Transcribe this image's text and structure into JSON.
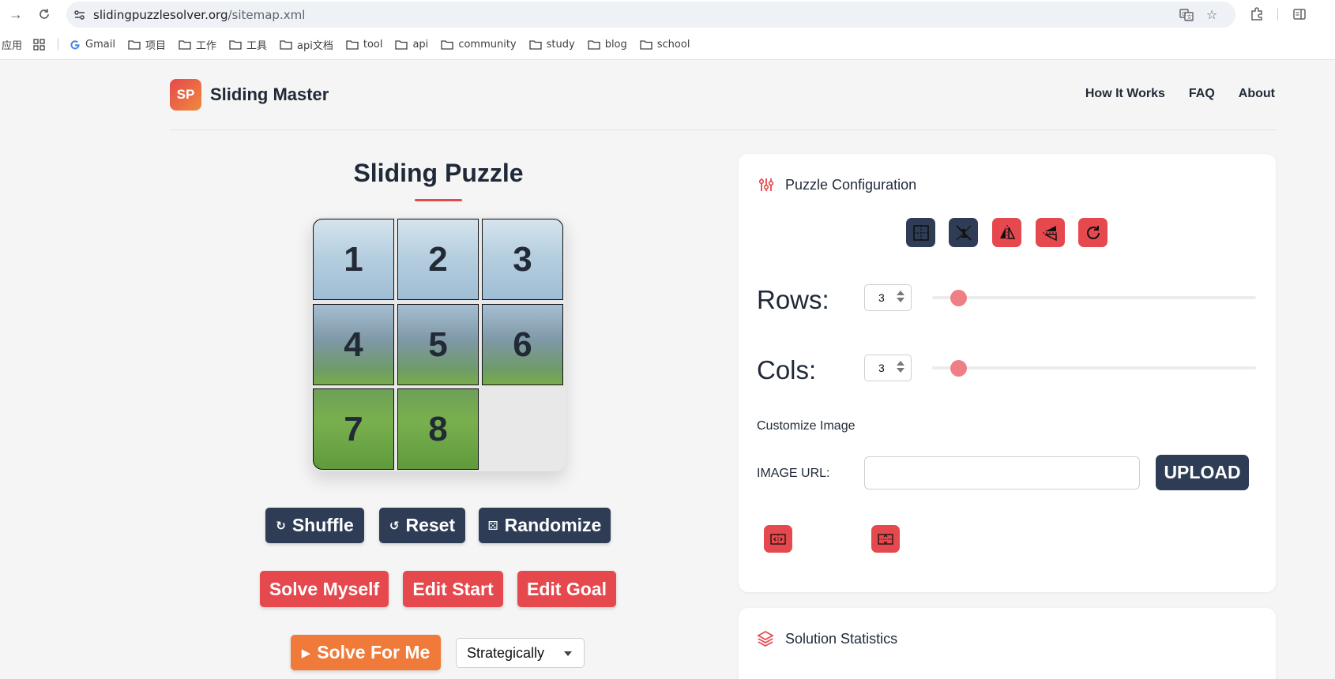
{
  "browser": {
    "url_domain": "slidingpuzzlesolver.org",
    "url_path": "/sitemap.xml",
    "bookmarks": [
      "应用",
      "Gmail",
      "项目",
      "工作",
      "工具",
      "api文档",
      "tool",
      "api",
      "community",
      "study",
      "blog",
      "school"
    ]
  },
  "header": {
    "logo_text": "SP",
    "brand": "Sliding Master",
    "nav": [
      "How It Works",
      "FAQ",
      "About"
    ]
  },
  "puzzle": {
    "title": "Sliding Puzzle",
    "tiles": [
      "1",
      "2",
      "3",
      "4",
      "5",
      "6",
      "7",
      "8",
      ""
    ],
    "buttons": {
      "shuffle": "Shuffle",
      "reset": "Reset",
      "randomize": "Randomize",
      "solve_myself": "Solve Myself",
      "edit_start": "Edit Start",
      "edit_goal": "Edit Goal",
      "solve_for_me": "Solve For Me"
    },
    "strategy_selected": "Strategically"
  },
  "config": {
    "title": "Puzzle Configuration",
    "rows_label": "Rows:",
    "rows_value": "3",
    "cols_label": "Cols:",
    "cols_value": "3",
    "rows_slider_fraction": 0.06,
    "cols_slider_fraction": 0.06,
    "customize_label": "Customize Image",
    "image_url_label": "IMAGE URL:",
    "image_url_value": "",
    "upload_label": "UPLOAD"
  },
  "stats": {
    "title": "Solution Statistics"
  },
  "colors": {
    "accent_red": "#e5484d",
    "navy": "#2e3c55",
    "orange": "#f07a3a"
  }
}
